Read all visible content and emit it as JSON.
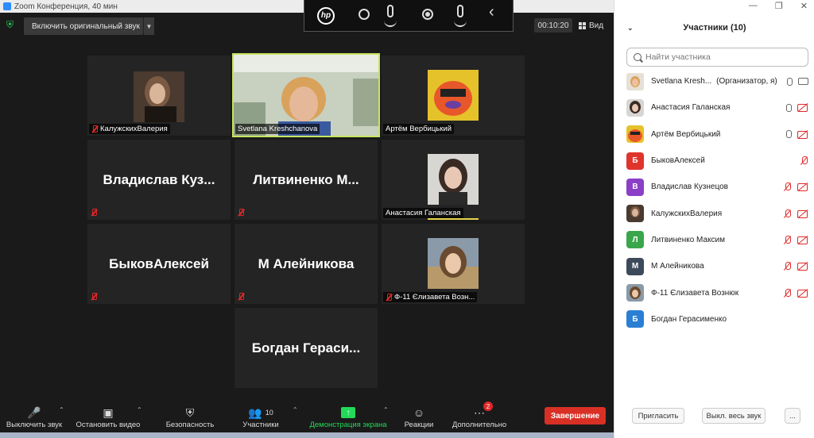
{
  "window": {
    "title": "Zoom Конференция, 40 мин"
  },
  "topbar": {
    "original_sound_label": "Включить оригинальный звук",
    "timer": "00:10:20",
    "view_label": "Вид"
  },
  "hp_toolbar": {
    "logo": "hp"
  },
  "tiles": [
    {
      "label": "КалужскихВалерия",
      "muted": true
    },
    {
      "label": "Svetlana Kreshchanova",
      "muted": false,
      "active": true
    },
    {
      "label": "Артём Вербицький",
      "muted": false
    },
    {
      "big_name": "Владислав  Куз...",
      "muted": true
    },
    {
      "big_name": "Литвиненко  М...",
      "muted": true
    },
    {
      "label": "Анастасия Галанская",
      "muted": false
    },
    {
      "big_name": "БыковАлексей",
      "muted": true
    },
    {
      "big_name": "М Алейникова",
      "muted": true
    },
    {
      "label": "Ф-11 Єлизавета Возн...",
      "muted": true
    },
    {
      "big_name": "Богдан  Гераси...",
      "muted": false
    }
  ],
  "toolbar": {
    "mute_label": "Выключить звук",
    "video_label": "Остановить видео",
    "security_label": "Безопасность",
    "participants_label": "Участники",
    "participants_count": "10",
    "share_label": "Демонстрация экрана",
    "reactions_label": "Реакции",
    "more_label": "Дополнительно",
    "more_badge": "2",
    "end_label": "Завершение"
  },
  "panel": {
    "title": "Участники (10)",
    "search_placeholder": "Найти участника",
    "participants": [
      {
        "name": "Svetlana Kresh...",
        "role": "(Организатор, я)",
        "avatar": "photo",
        "color": "#c9a27a",
        "mic": "on",
        "cam": "on"
      },
      {
        "name": "Анастасия Галанская",
        "avatar": "photo",
        "color": "#5a4a44",
        "mic": "on",
        "cam": "off"
      },
      {
        "name": "Артём Вербицький",
        "avatar": "photo",
        "color": "#e8572a",
        "mic": "on",
        "cam": "off"
      },
      {
        "name": "БыковАлексей",
        "avatar": "Б",
        "color": "#e0352c",
        "mic": "none",
        "cam": "off"
      },
      {
        "name": "Владислав Кузнецов",
        "avatar": "В",
        "color": "#8b3fc7",
        "mic": "off",
        "cam": "off"
      },
      {
        "name": "КалужскихВалерия",
        "avatar": "photo",
        "color": "#6b4a36",
        "mic": "off",
        "cam": "off"
      },
      {
        "name": "Литвиненко Максим",
        "avatar": "Л",
        "color": "#3aa64c",
        "mic": "off",
        "cam": "off"
      },
      {
        "name": "М Алейникова",
        "avatar": "М",
        "color": "#3c4a5c",
        "mic": "off",
        "cam": "off"
      },
      {
        "name": "Ф-11 Єлизавета Вознюк",
        "avatar": "photo",
        "color": "#b08a6a",
        "mic": "off",
        "cam": "off"
      },
      {
        "name": "Богдан Герасименко",
        "avatar": "Б",
        "color": "#2a7fd4",
        "mic": "none",
        "cam": "none"
      }
    ],
    "invite_label": "Пригласить",
    "mute_all_label": "Выкл. весь звук",
    "more_label": "..."
  }
}
